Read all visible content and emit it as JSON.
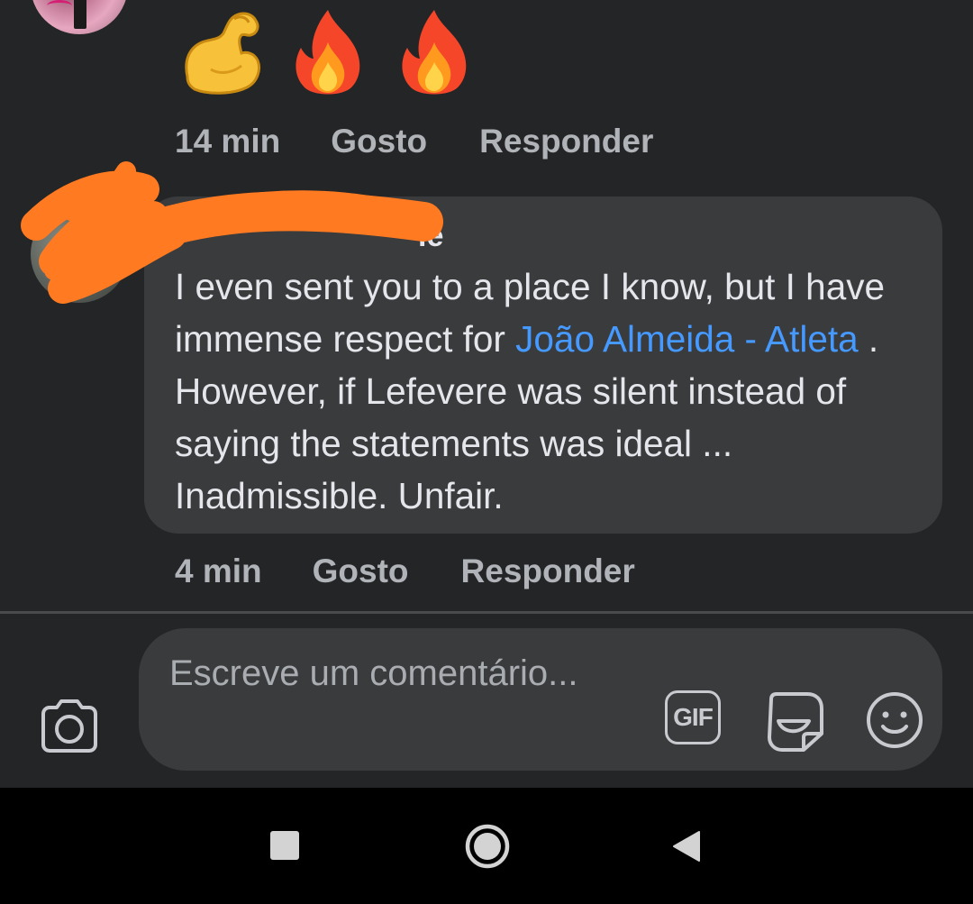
{
  "previous_comment": {
    "reactions_emoji": [
      "💪",
      "🔥",
      "🔥"
    ],
    "meta": {
      "time": "14 min",
      "like_label": "Gosto",
      "reply_label": "Responder"
    }
  },
  "comment": {
    "author_visible_fragment": "le",
    "text_before_mention": "I even sent you to a place I know, but I have immense respect for ",
    "mention": "João Almeida - Atleta",
    "text_after_mention": " . However, if Lefevere was silent instead of saying the statements was ideal ... Inadmissible. Unfair.",
    "meta": {
      "time": "4 min",
      "like_label": "Gosto",
      "reply_label": "Responder"
    }
  },
  "composer": {
    "placeholder": "Escreve um comentário...",
    "gif_label": "GIF",
    "icons": [
      "camera-icon",
      "gif-icon",
      "sticker-icon",
      "emoji-icon"
    ]
  },
  "navbar": {
    "icons": [
      "recent-apps-icon",
      "home-icon",
      "back-icon"
    ]
  },
  "colors": {
    "background": "#242526",
    "bubble": "#3a3b3c",
    "text_primary": "#e4e6eb",
    "text_secondary": "#b0b3b8",
    "mention": "#4599ff",
    "redaction": "#ff7a21"
  }
}
